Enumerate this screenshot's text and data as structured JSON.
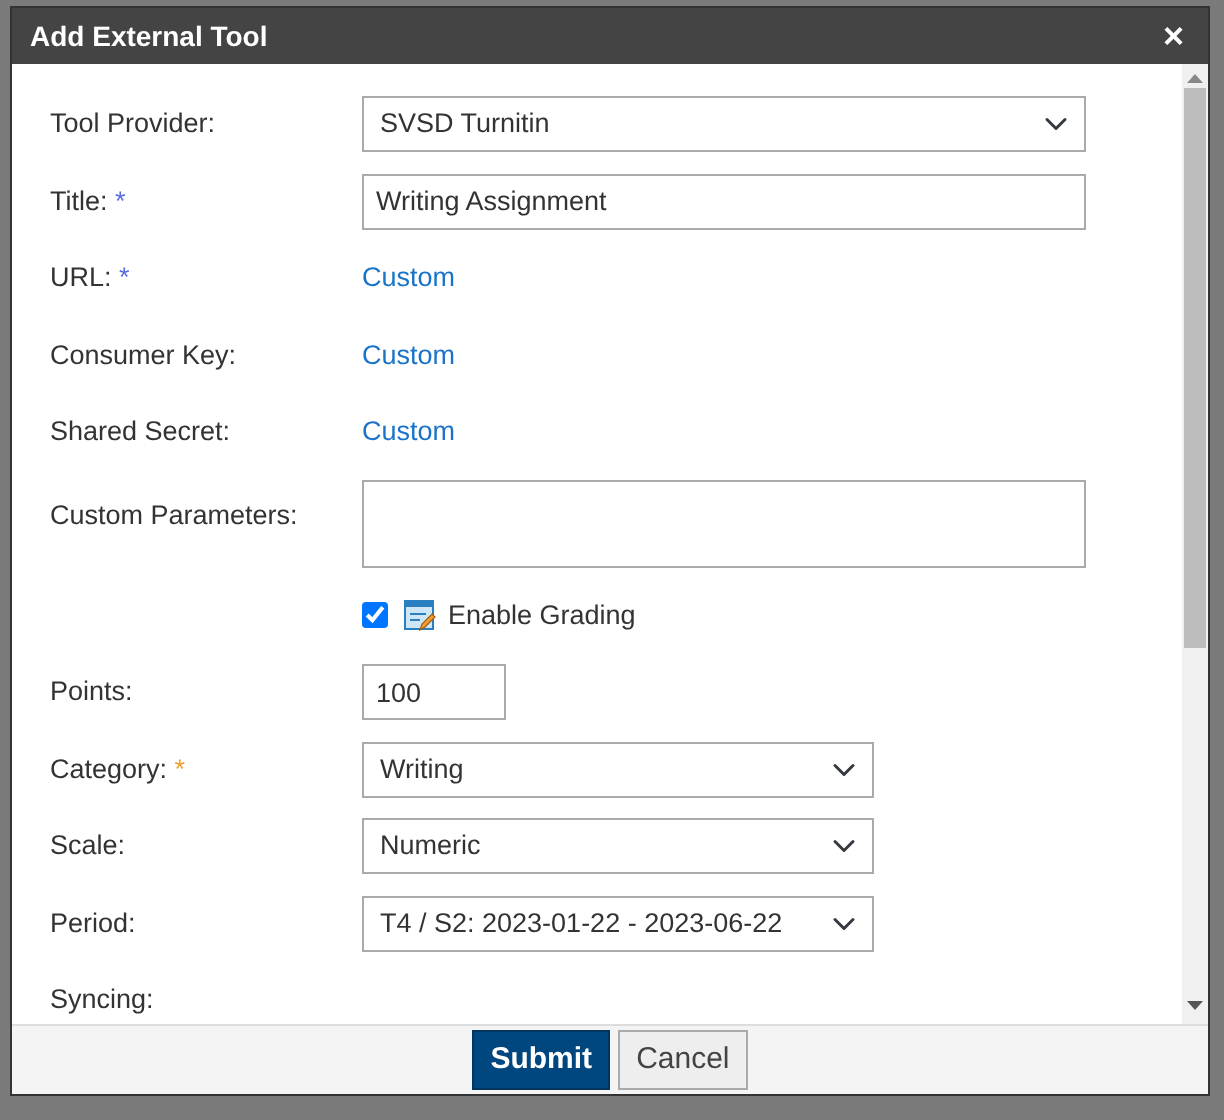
{
  "dialog": {
    "title": "Add External Tool",
    "close": "×"
  },
  "fields": [
    {
      "kind": "select",
      "label": "Tool Provider:",
      "value": "SVSD Turnitin"
    },
    {
      "kind": "text",
      "label": "Title:",
      "required_mark": "*",
      "color": "#5b6ee1",
      "value": "Writing Assignment"
    },
    {
      "kind": "link",
      "label": "URL:",
      "required_mark": "*",
      "color": "#5b6ee1",
      "value": "Custom"
    },
    {
      "kind": "link",
      "label": "Consumer Key:",
      "value": "Custom"
    },
    {
      "kind": "link",
      "label": "Shared Secret:",
      "value": "Custom"
    },
    {
      "kind": "textarea",
      "label": "Custom Parameters:"
    },
    {
      "kind": "checkbox",
      "label": "Enable Grading",
      "checked": true
    },
    {
      "kind": "text",
      "label": "Points:",
      "value": "100"
    },
    {
      "kind": "select",
      "label": "Category:",
      "required_mark": "*",
      "color": "#f0a030",
      "value": "Writing"
    },
    {
      "kind": "select",
      "label": "Scale:",
      "value": "Numeric"
    },
    {
      "kind": "select",
      "label": "Period:",
      "value": "T4 / S2: 2023-01-22 - 2023-06-22"
    },
    {
      "kind": "heading",
      "label": "Syncing:"
    }
  ],
  "buttons": [
    {
      "label": "Submit",
      "kind": "primary"
    },
    {
      "label": "Cancel",
      "kind": "secondary"
    }
  ]
}
